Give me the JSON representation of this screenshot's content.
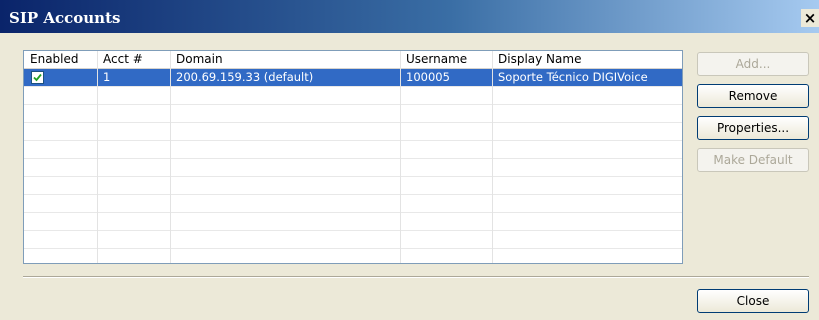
{
  "window": {
    "title": "SIP Accounts",
    "close_glyph": "×"
  },
  "table": {
    "columns": [
      "Enabled",
      "Acct #",
      "Domain",
      "Username",
      "Display Name"
    ],
    "rows": [
      {
        "enabled": true,
        "acct": "1",
        "domain": "200.69.159.33 (default)",
        "username": "100005",
        "display_name": "Soporte Técnico DIGIVoice"
      }
    ]
  },
  "buttons": {
    "add": "Add...",
    "remove": "Remove",
    "properties": "Properties...",
    "make_default": "Make Default",
    "close": "Close"
  },
  "colors": {
    "selection": "#316ac5",
    "titlebar_start": "#0a246a",
    "face": "#ece9d8"
  }
}
